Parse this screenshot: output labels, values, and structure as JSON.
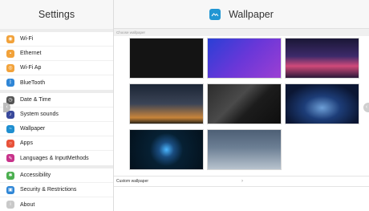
{
  "sidebar": {
    "title": "Settings",
    "groups": [
      {
        "items": [
          {
            "label": "Wi-Fi",
            "icon": "wifi-icon",
            "color": "orange"
          },
          {
            "label": "Ethernet",
            "icon": "ethernet-icon",
            "color": "orange"
          },
          {
            "label": "Wi-Fi Ap",
            "icon": "hotspot-icon",
            "color": "orange"
          },
          {
            "label": "BlueTooth",
            "icon": "bluetooth-icon",
            "color": "blue"
          }
        ]
      },
      {
        "items": [
          {
            "label": "Date & Time",
            "icon": "clock-icon",
            "color": "dark"
          },
          {
            "label": "System sounds",
            "icon": "speaker-icon",
            "color": "navy"
          },
          {
            "label": "Wallpaper",
            "icon": "wallpaper-icon",
            "color": "sky"
          },
          {
            "label": "Apps",
            "icon": "apps-icon",
            "color": "red"
          },
          {
            "label": "Languages & InputMethods",
            "icon": "language-icon",
            "color": "magenta"
          }
        ]
      },
      {
        "items": [
          {
            "label": "Accessibility",
            "icon": "accessibility-icon",
            "color": "green"
          },
          {
            "label": "Security & Restrictions",
            "icon": "lock-icon",
            "color": "blue"
          },
          {
            "label": "About",
            "icon": "info-icon",
            "color": "gray"
          }
        ]
      }
    ]
  },
  "main": {
    "title": "Wallpaper",
    "section_label": "Choose wallpaper",
    "custom_label": "Custom wallpaper",
    "wallpapers": [
      {
        "name": "dark-plain",
        "style": "solid-black"
      },
      {
        "name": "blue-purple-gradient",
        "style": "gradient"
      },
      {
        "name": "pink-horizon",
        "style": "gradient"
      },
      {
        "name": "milky-way-night",
        "style": "gradient"
      },
      {
        "name": "dark-diagonal",
        "style": "gradient"
      },
      {
        "name": "blue-galaxy",
        "style": "gradient"
      },
      {
        "name": "blue-glow-orb",
        "style": "radial"
      },
      {
        "name": "blue-gray-fog",
        "style": "gradient"
      }
    ]
  },
  "colors": {
    "accent": "#2196d3"
  }
}
